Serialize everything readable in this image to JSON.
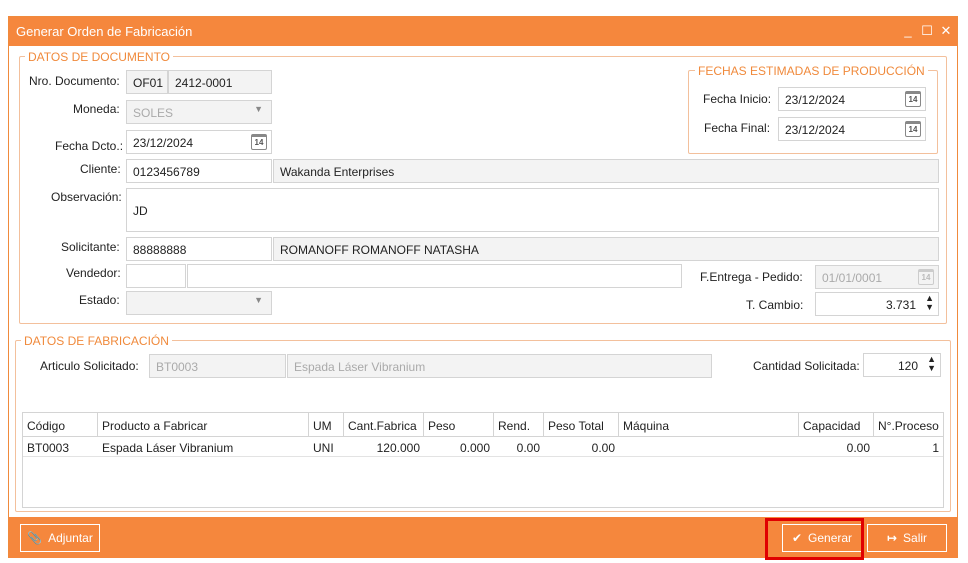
{
  "window": {
    "title": "Generar Orden de Fabricación",
    "controls": {
      "minimize": "_",
      "maximize": "☐",
      "close": "✕"
    }
  },
  "documento": {
    "title": "DATOS DE DOCUMENTO",
    "nro_label": "Nro. Documento:",
    "serie": "OF01",
    "numero": "2412-0001",
    "moneda_label": "Moneda:",
    "moneda": "SOLES",
    "fecha_label": "Fecha Dcto.:",
    "fecha": "23/12/2024",
    "cliente_label": "Cliente:",
    "cliente_codigo": "0123456789",
    "cliente_nombre": "Wakanda Enterprises",
    "observacion_label": "Observación:",
    "observacion": "JD",
    "solicitante_label": "Solicitante:",
    "solicitante_codigo": "88888888",
    "solicitante_nombre": "ROMANOFF ROMANOFF NATASHA",
    "vendedor_label": "Vendedor:",
    "vendedor_codigo": "",
    "vendedor_nombre": "",
    "estado_label": "Estado:",
    "estado": "",
    "fentrega_label": "F.Entrega - Pedido:",
    "fentrega": "01/01/0001",
    "tcambio_label": "T. Cambio:",
    "tcambio": "3.731"
  },
  "fechas": {
    "title": "FECHAS ESTIMADAS DE PRODUCCIÓN",
    "inicio_label": "Fecha Inicio:",
    "inicio": "23/12/2024",
    "final_label": "Fecha Final:",
    "final": "23/12/2024"
  },
  "fabricacion": {
    "title": "DATOS DE FABRICACIÓN",
    "articulo_label": "Articulo Solicitado:",
    "articulo_codigo": "BT0003",
    "articulo_nombre": "Espada Láser Vibranium",
    "cantidad_label": "Cantidad Solicitada:",
    "cantidad": "120"
  },
  "calendar_icon": "14",
  "table": {
    "columns": [
      "Código",
      "Producto a Fabricar",
      "UM",
      "Cant.Fabrica",
      "Peso",
      "Rend.",
      "Peso Total",
      "Máquina",
      "Capacidad",
      "N°.Proceso"
    ],
    "rows": [
      [
        "BT0003",
        "Espada Láser Vibranium",
        "UNI",
        "120.000",
        "0.000",
        "0.00",
        "0.00",
        "",
        "0.00",
        "1"
      ]
    ]
  },
  "footer": {
    "adjuntar": "Adjuntar",
    "adjuntar_icon": "paperclip-icon",
    "generar": "Generar",
    "generar_icon": "check-icon",
    "salir": "Salir",
    "salir_icon": "exit-icon",
    "accent": "#f5873d",
    "highlight": "#e00000"
  }
}
